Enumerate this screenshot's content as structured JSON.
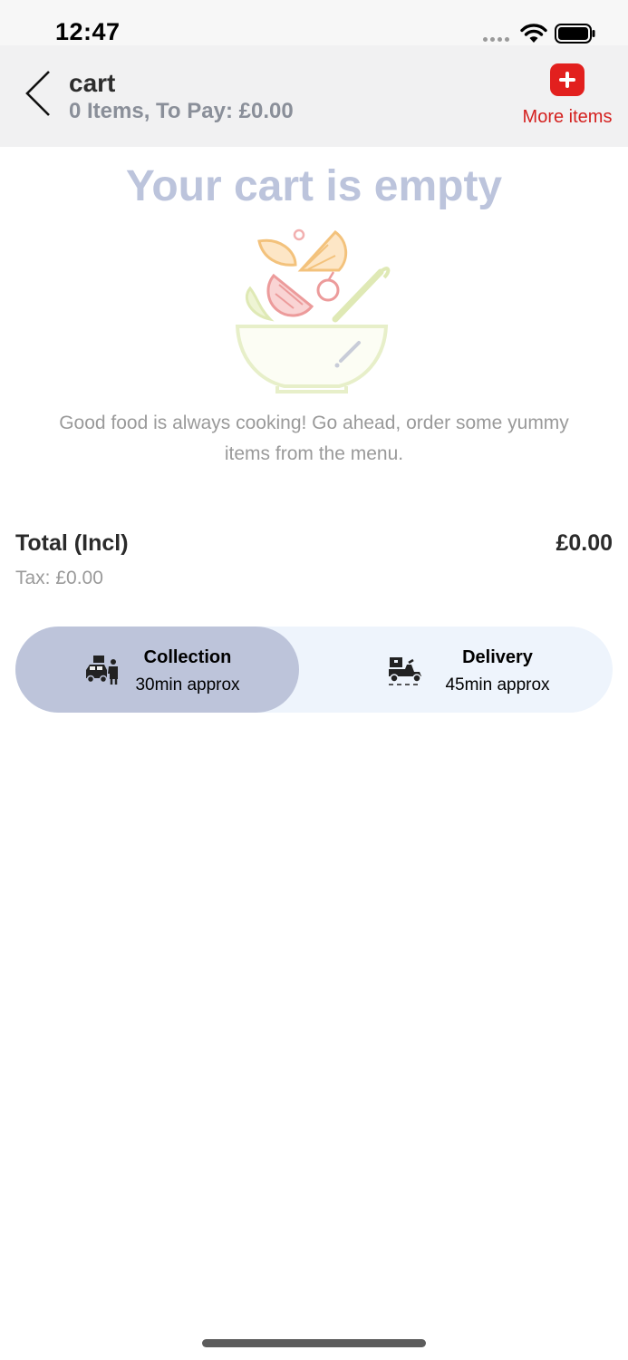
{
  "status_bar": {
    "time": "12:47"
  },
  "header": {
    "title": "cart",
    "subtitle": "0 Items, To Pay: £0.00",
    "more_items_label": "More items"
  },
  "empty_state": {
    "title": "Your cart is empty",
    "message": "Good food is always cooking! Go ahead, order some yummy items from the menu."
  },
  "totals": {
    "total_label": "Total (Incl)",
    "total_value": "£0.00",
    "tax_label": "Tax: £0.00"
  },
  "order_type": {
    "selected": "collection",
    "options": [
      {
        "id": "collection",
        "title": "Collection",
        "subtitle": "30min approx",
        "icon": "collection-car-icon"
      },
      {
        "id": "delivery",
        "title": "Delivery",
        "subtitle": "45min approx",
        "icon": "delivery-scooter-icon"
      }
    ]
  },
  "colors": {
    "accent_red": "#e2201e",
    "selected_pill": "#bdc4da",
    "toggle_bg": "#eef4fc",
    "empty_title": "#bcc4dc"
  }
}
